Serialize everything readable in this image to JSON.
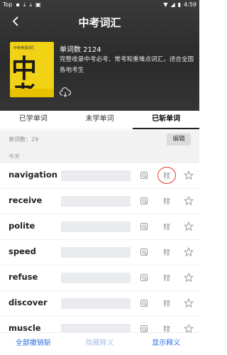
{
  "status_bar": {
    "carrier": "Top",
    "left_icons": [
      "sim-icon",
      "download-icon",
      "download-icon",
      "image-icon"
    ],
    "time": "4:59"
  },
  "header": {
    "title": "中考词汇",
    "word_count_label": "单词数 2124",
    "description": "完整收录中考必考、常考和重难点词汇，适合全国各地考生",
    "cover": {
      "small_text": "中考英语词汇",
      "big_text": "中考"
    }
  },
  "tabs": [
    {
      "label": "已学单词",
      "active": false
    },
    {
      "label": "未学单词",
      "active": false
    },
    {
      "label": "已斩单词",
      "active": true
    }
  ],
  "list_header": {
    "count_text": "单词数：29",
    "edit_label": "编辑",
    "section_label": "今天"
  },
  "words": [
    {
      "word": "navigation",
      "circled": true
    },
    {
      "word": "receive",
      "circled": false
    },
    {
      "word": "polite",
      "circled": false
    },
    {
      "word": "speed",
      "circled": false
    },
    {
      "word": "refuse",
      "circled": false
    },
    {
      "word": "discover",
      "circled": false
    },
    {
      "word": "muscle",
      "circled": false
    }
  ],
  "bottom_bar": {
    "undo_all_label": "全部撤销斩",
    "hide_meaning_label": "隐藏释义",
    "show_meaning_label": "显示释义"
  },
  "colors": {
    "accent": "#2f6fe0",
    "accent_disabled": "#a9c1ea",
    "highlight_ring": "#e23b2a",
    "cover_yellow": "#f2d215"
  }
}
